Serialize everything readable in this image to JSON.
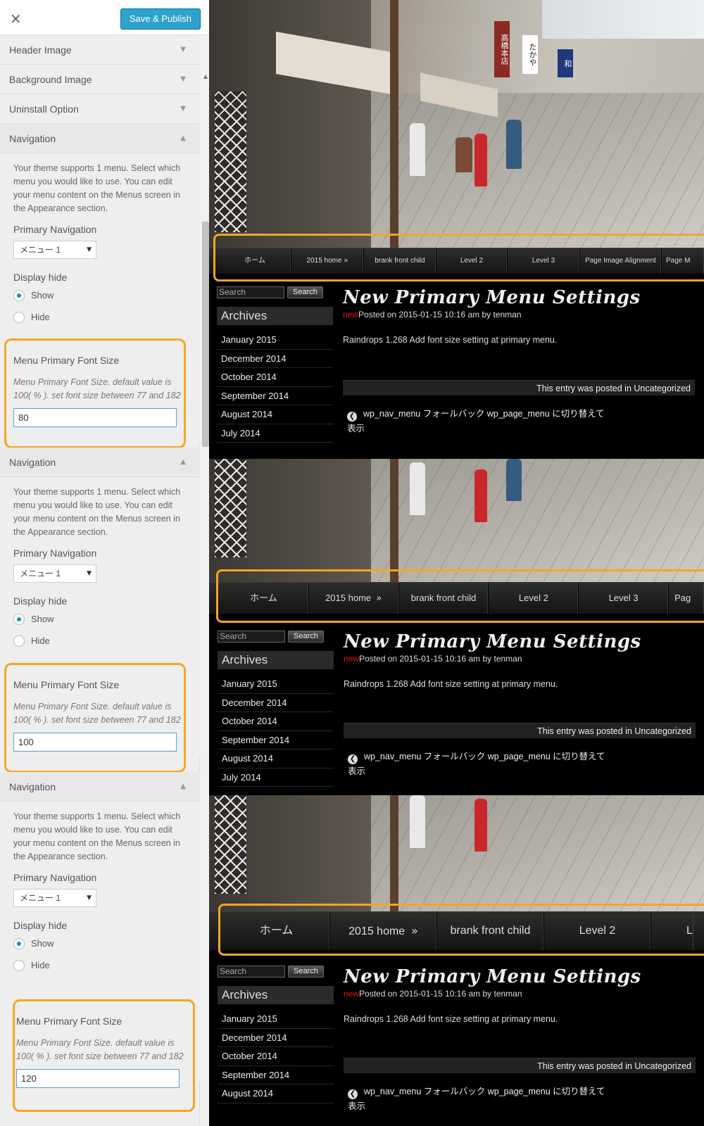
{
  "customizer": {
    "close_icon": "×",
    "save_label": "Save & Publish",
    "sections": [
      "Header Image",
      "Background Image",
      "Uninstall Option"
    ],
    "panels": [
      {
        "section_title": "Navigation",
        "description": "Your theme supports 1 menu. Select which menu you would like to use. You can edit your menu content on the Menus screen in the Appearance section.",
        "primary_nav_label": "Primary Navigation",
        "primary_nav_value": "メニュー 1",
        "display_hide_label": "Display hide",
        "show_label": "Show",
        "hide_label": "Hide",
        "font_size_label": "Menu Primary Font Size",
        "font_size_desc": "Menu Primary Font Size. default value is 100( % ). set font size between 77 and 182",
        "font_size_value": "80"
      },
      {
        "section_title": "Navigation",
        "description": "Your theme supports 1 menu. Select which menu you would like to use. You can edit your menu content on the Menus screen in the Appearance section.",
        "primary_nav_label": "Primary Navigation",
        "primary_nav_value": "メニュー 1",
        "display_hide_label": "Display hide",
        "show_label": "Show",
        "hide_label": "Hide",
        "font_size_label": "Menu Primary Font Size",
        "font_size_desc": "Menu Primary Font Size. default value is 100( % ). set font size between 77 and 182",
        "font_size_value": "100"
      },
      {
        "section_title": "Navigation",
        "description": "Your theme supports 1 menu. Select which menu you would like to use. You can edit your menu content on the Menus screen in the Appearance section.",
        "primary_nav_label": "Primary Navigation",
        "primary_nav_value": "メニュー 1",
        "display_hide_label": "Display hide",
        "show_label": "Show",
        "hide_label": "Hide",
        "font_size_label": "Menu Primary Font Size",
        "font_size_desc": "Menu Primary Font Size. default value is 100( % ). set font size between 77 and 182",
        "font_size_value": "120"
      }
    ]
  },
  "preview": {
    "menu_items": [
      "ホーム",
      "2015 home",
      "brank front child",
      "Level 2",
      "Level 3",
      "Page Image Alignment",
      "Page M"
    ],
    "menu_items_2": [
      "ホーム",
      "2015 home",
      "brank front child",
      "Level 2",
      "Level 3",
      "Pag"
    ],
    "menu_items_3": [
      "ホーム",
      "2015 home",
      "brank front child",
      "Level 2",
      "L"
    ],
    "dropdown_arrow": "»",
    "search_placeholder": "Search",
    "search_button": "Search",
    "archives_title": "Archives",
    "archives": [
      "January 2015",
      "December 2014",
      "October 2014",
      "September 2014",
      "August 2014",
      "July 2014"
    ],
    "post_title": "New Primary Menu Settings",
    "post_new": "new",
    "post_meta": "Posted on 2015-01-15 10:16 am by tenman",
    "post_body": "Raindrops 1.268 Add font size setting at primary menu.",
    "post_footer": "This entry was posted in Uncategorized",
    "prev_icon": "❮",
    "prev_link": "wp_nav_menu フォールバック wp_page_menu に切り替えて 表示"
  }
}
